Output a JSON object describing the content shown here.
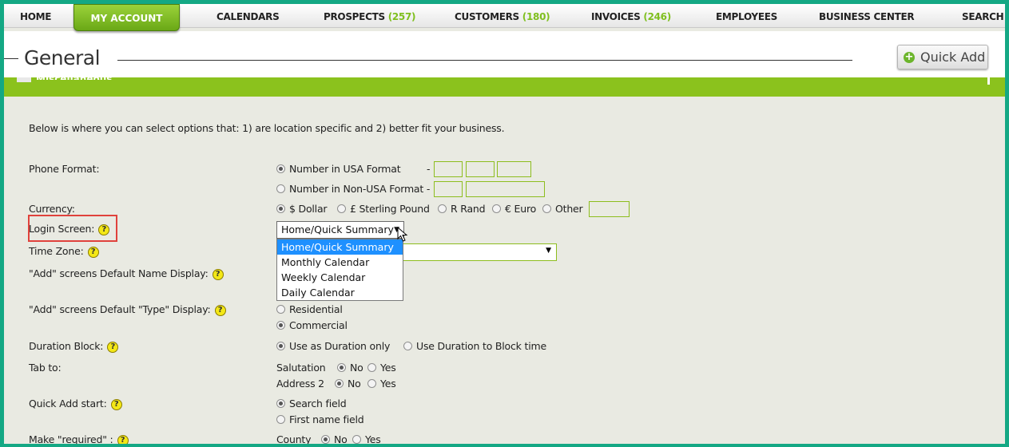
{
  "nav": {
    "home": "HOME",
    "account": "MY ACCOUNT",
    "calendars": "CALENDARS",
    "prospects": "PROSPECTS",
    "prospects_count": "(257)",
    "customers": "CUSTOMERS",
    "customers_count": "(180)",
    "invoices": "INVOICES",
    "invoices_count": "(246)",
    "employees": "EMPLOYEES",
    "business_center": "BUSINESS CENTER",
    "search": "SEARCH"
  },
  "header": {
    "title": "General",
    "quick_add": "Quick Add"
  },
  "section": {
    "label": "Miscellaneous"
  },
  "intro": "Below is where you can select options that: 1) are location specific and 2) better fit your business.",
  "help_glyph": "?",
  "phone": {
    "label": "Phone Format:",
    "usa": "Number in USA Format",
    "usa_dash": "-",
    "non_usa": "Number in Non-USA Format -"
  },
  "currency": {
    "label": "Currency:",
    "dollar": "$ Dollar",
    "pound": "£ Sterling Pound",
    "rand": "R Rand",
    "euro": "€ Euro",
    "other": "Other"
  },
  "login": {
    "label": "Login Screen:",
    "selected": "Home/Quick Summary",
    "options": [
      "Home/Quick Summary",
      "Monthly Calendar",
      "Weekly Calendar",
      "Daily Calendar"
    ]
  },
  "timezone": {
    "label": "Time Zone:"
  },
  "name_display": {
    "label": "\"Add\" screens Default Name Display:"
  },
  "type_display": {
    "label": "\"Add\" screens Default \"Type\" Display:",
    "residential": "Residential",
    "commercial": "Commercial"
  },
  "duration": {
    "label": "Duration Block:",
    "only": "Use as Duration only",
    "block": "Use Duration to Block time"
  },
  "tab_to": {
    "label": "Tab to:",
    "salutation": "Salutation",
    "address2": "Address 2",
    "no": "No",
    "yes": "Yes"
  },
  "quick_add_start": {
    "label": "Quick Add start:",
    "search": "Search field",
    "first_name": "First name field"
  },
  "make_required": {
    "label": "Make \"required\" :",
    "county": "County",
    "no": "No",
    "yes": "Yes"
  },
  "colors": {
    "accent_green": "#8bc21d",
    "frame_teal": "#14a884",
    "highlight_red": "#e0423c",
    "select_blue": "#1e90ff"
  }
}
